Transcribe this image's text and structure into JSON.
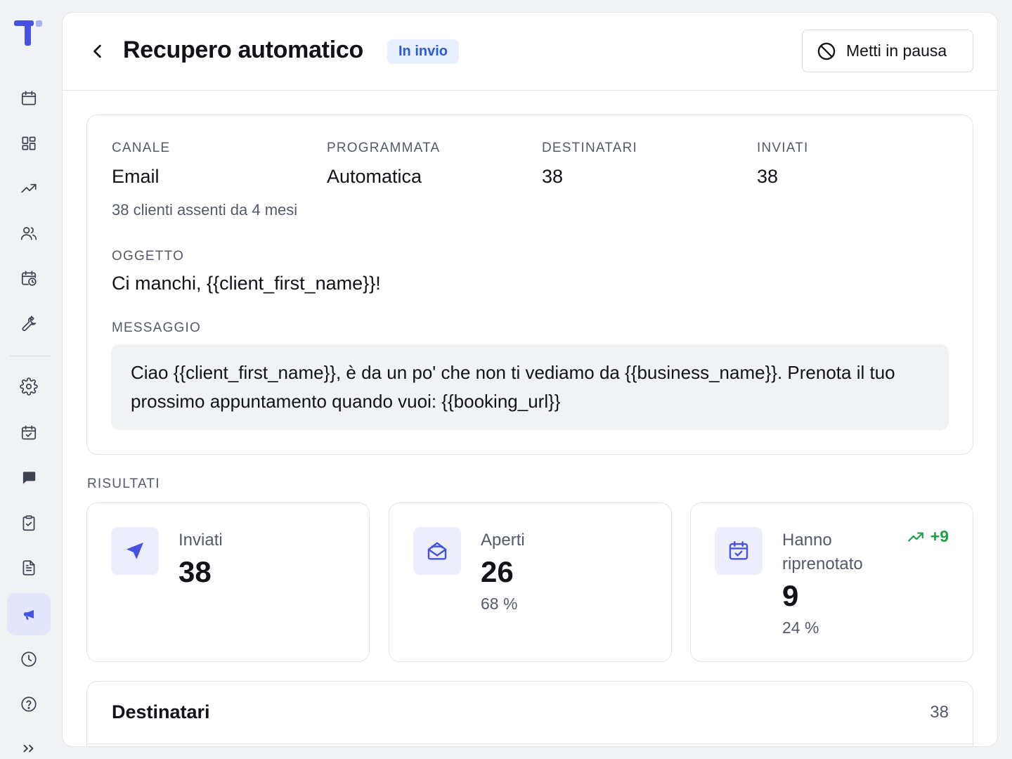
{
  "sidebar": {
    "items": [
      {
        "name": "calendar-icon",
        "active": false
      },
      {
        "name": "dashboard-icon",
        "active": false
      },
      {
        "name": "trend-icon",
        "active": false
      },
      {
        "name": "users-icon",
        "active": false
      },
      {
        "name": "calendar-clock-icon",
        "active": false
      },
      {
        "name": "wrench-icon",
        "active": false
      },
      {
        "name": "settings-icon",
        "active": false
      },
      {
        "name": "calendar-check-icon",
        "active": false
      },
      {
        "name": "chat-icon",
        "active": false
      },
      {
        "name": "clipboard-check-icon",
        "active": false
      },
      {
        "name": "document-icon",
        "active": false
      },
      {
        "name": "megaphone-icon",
        "active": true
      },
      {
        "name": "clock-icon",
        "active": false
      },
      {
        "name": "help-icon",
        "active": false
      }
    ]
  },
  "header": {
    "title": "Recupero automatico",
    "status": "In invio",
    "pause_label": "Metti in pausa"
  },
  "details": {
    "channel": {
      "label": "CANALE",
      "value": "Email"
    },
    "scheduled": {
      "label": "PROGRAMMATA",
      "value": "Automatica"
    },
    "recipients": {
      "label": "DESTINATARI",
      "value": "38"
    },
    "sent": {
      "label": "INVIATI",
      "value": "38"
    },
    "audience_note": "38 clienti assenti da 4 mesi",
    "subject_label": "OGGETTO",
    "subject": "Ci manchi, {{client_first_name}}!",
    "message_label": "MESSAGGIO",
    "message": "Ciao {{client_first_name}}, è da un po' che non ti vediamo da {{business_name}}. Prenota il tuo prossimo appuntamento quando vuoi: {{booking_url}}"
  },
  "results": {
    "label": "RISULTATI",
    "cards": [
      {
        "label": "Inviati",
        "value": "38",
        "pct": ""
      },
      {
        "label": "Aperti",
        "value": "26",
        "pct": "68 %"
      },
      {
        "label": "Hanno riprenotato",
        "value": "9",
        "pct": "24 %",
        "trend": "+9"
      }
    ]
  },
  "recipients_section": {
    "title": "Destinatari",
    "count": "38"
  },
  "colors": {
    "accent": "#4553e0",
    "badge_bg": "#e8efff",
    "badge_text": "#2a5bd7",
    "trend_green": "#1e9e4a"
  }
}
